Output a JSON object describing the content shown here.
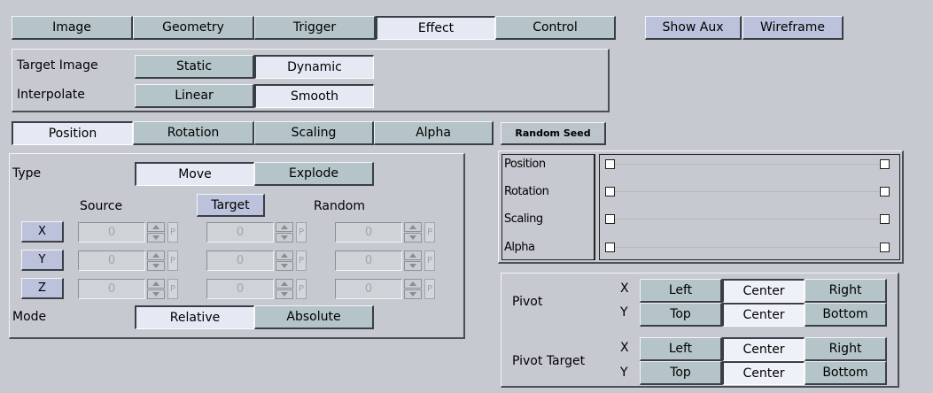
{
  "tabs": [
    {
      "label": "Image",
      "active": false
    },
    {
      "label": "Geometry",
      "active": false
    },
    {
      "label": "Trigger",
      "active": false
    },
    {
      "label": "Effect",
      "active": true
    },
    {
      "label": "Control",
      "active": false
    }
  ],
  "toolbar": {
    "show_aux": "Show Aux",
    "wireframe": "Wireframe"
  },
  "target_image": {
    "label": "Target Image",
    "options": [
      "Static",
      "Dynamic"
    ],
    "selected": "Dynamic"
  },
  "interpolate": {
    "label": "Interpolate",
    "options": [
      "Linear",
      "Smooth"
    ],
    "selected": "Smooth"
  },
  "sub_tabs": [
    {
      "label": "Position",
      "active": true
    },
    {
      "label": "Rotation",
      "active": false
    },
    {
      "label": "Scaling",
      "active": false
    },
    {
      "label": "Alpha",
      "active": false
    }
  ],
  "random_seed": "Random Seed",
  "type": {
    "label": "Type",
    "options": [
      "Move",
      "Explode"
    ],
    "selected": "Move"
  },
  "columns": {
    "source": "Source",
    "target": "Target",
    "random": "Random"
  },
  "axes": [
    {
      "name": "X",
      "source": "0",
      "target": "0",
      "random": "0"
    },
    {
      "name": "Y",
      "source": "0",
      "target": "0",
      "random": "0"
    },
    {
      "name": "Z",
      "source": "0",
      "target": "0",
      "random": "0"
    }
  ],
  "spin_suffix": "P",
  "mode": {
    "label": "Mode",
    "options": [
      "Relative",
      "Absolute"
    ],
    "selected": "Relative"
  },
  "tracks": [
    "Position",
    "Rotation",
    "Scaling",
    "Alpha"
  ],
  "pivot": {
    "label": "Pivot",
    "x_label": "X",
    "y_label": "Y",
    "x_options": [
      "Left",
      "Center",
      "Right"
    ],
    "x_selected": "Center",
    "y_options": [
      "Top",
      "Center",
      "Bottom"
    ],
    "y_selected": "Center"
  },
  "pivot_target": {
    "label": "Pivot Target",
    "x_label": "X",
    "y_label": "Y",
    "x_options": [
      "Left",
      "Center",
      "Right"
    ],
    "x_selected": "Center",
    "y_options": [
      "Top",
      "Center",
      "Bottom"
    ],
    "y_selected": "Center"
  }
}
